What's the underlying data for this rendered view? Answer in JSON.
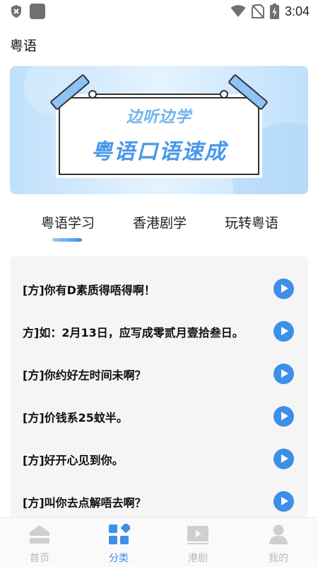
{
  "status_bar": {
    "time": "3:04"
  },
  "page": {
    "title": "粤语"
  },
  "banner": {
    "line1": "边听边学",
    "line2": "粤语口语速成"
  },
  "tabs": [
    {
      "label": "粤语学习",
      "active": true
    },
    {
      "label": "香港剧学",
      "active": false
    },
    {
      "label": "玩转粤语",
      "active": false
    }
  ],
  "phrases": [
    {
      "text": "[方]你有D素质得唔得啊！"
    },
    {
      "text": "方]如：2月13日，应写成零贰月壹拾叁日。"
    },
    {
      "text": "[方]你约好左时间未啊？"
    },
    {
      "text": "[方]价钱系25蚊半。"
    },
    {
      "text": "[方]好开心见到你。"
    },
    {
      "text": "[方]叫你去点解唔去啊？"
    }
  ],
  "bottom_nav": [
    {
      "label": "首页",
      "icon": "home-icon",
      "active": false
    },
    {
      "label": "分类",
      "icon": "category-icon",
      "active": true
    },
    {
      "label": "港剧",
      "icon": "video-icon",
      "active": false
    },
    {
      "label": "我的",
      "icon": "profile-icon",
      "active": false
    }
  ],
  "colors": {
    "accent": "#3d8fe8",
    "inactive": "#b8b8b8",
    "list_bg": "#f5f5f5"
  }
}
